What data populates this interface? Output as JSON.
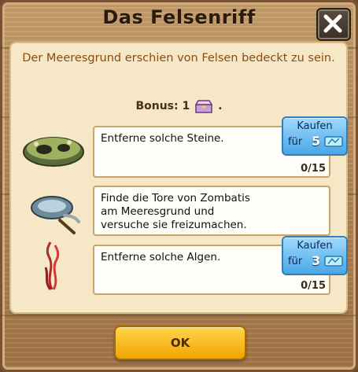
{
  "dialog": {
    "title": "Das Felsenriff",
    "intro": "Der Meeresgrund erschien von Felsen bedeckt zu sein.",
    "bonus_label": "Bonus: 1",
    "bonus_suffix": ".",
    "ok_label": "OK"
  },
  "tasks": [
    {
      "text": "Entferne solche Steine.",
      "progress": "0/15",
      "buy": {
        "label": "Kaufen",
        "prefix": "für",
        "cost": "5"
      }
    },
    {
      "text": "Finde die Tore von Zombatis\nam Meeresgrund und\nversuche sie freizumachen."
    },
    {
      "text": "Entferne solche Algen.",
      "progress": "0/15",
      "buy": {
        "label": "Kaufen",
        "prefix": "für",
        "cost": "3"
      }
    }
  ],
  "icons": {
    "close": "close-x-icon",
    "bonus": "chest-icon",
    "task1": "stone-icon",
    "task2": "gate-pickaxe-icon",
    "task3": "algae-icon",
    "currency": "ticket-icon"
  },
  "colors": {
    "title": "#2b1a0d",
    "intro": "#8a4a12",
    "buy_button": "#4aa6e6",
    "ok_button": "#f2a400"
  }
}
